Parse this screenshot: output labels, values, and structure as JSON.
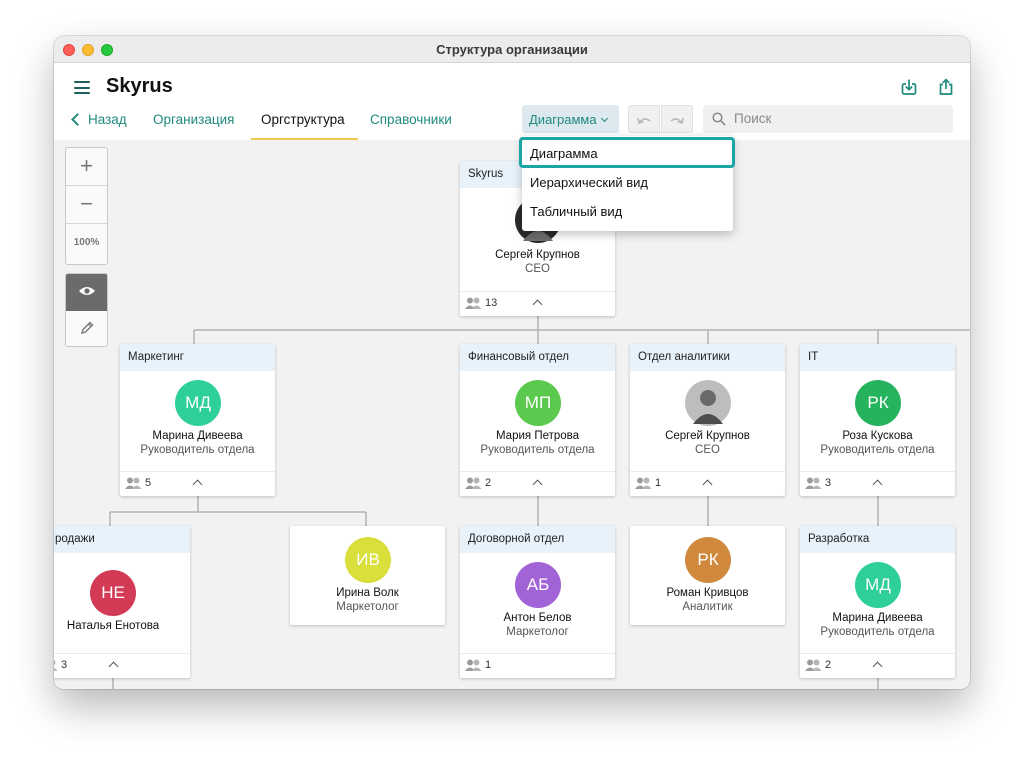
{
  "window": {
    "title": "Структура организации"
  },
  "app": {
    "name": "Skyrus"
  },
  "nav": {
    "back": "Назад",
    "tabs": [
      "Организация",
      "Оргструктура",
      "Справочники"
    ]
  },
  "view_select": {
    "value": "Диаграмма",
    "options": [
      "Диаграмма",
      "Иерархический вид",
      "Табличный вид"
    ]
  },
  "search": {
    "placeholder": "Поиск"
  },
  "zoom": {
    "plus": "+",
    "minus": "−",
    "level": "100%"
  },
  "colors": {
    "accent": "#1f8a7d",
    "tab_underline": "#f2c94c",
    "card_header": "#e8f2fb",
    "highlight": "#1aa6a6"
  },
  "cards": {
    "root": {
      "dept": "Skyrus",
      "name": "Сергей Крупнов",
      "role": "CEO",
      "count": "13",
      "avatar": "photo"
    },
    "marketing": {
      "dept": "Маркетинг",
      "initials": "МД",
      "color": "#2ecf9a",
      "name": "Марина Дивеева",
      "role": "Руководитель отдела",
      "count": "5"
    },
    "finance": {
      "dept": "Финансовый отдел",
      "initials": "МП",
      "color": "#5bc94e",
      "name": "Мария Петрова",
      "role": "Руководитель отдела",
      "count": "2"
    },
    "analytics": {
      "dept": "Отдел аналитики",
      "name": "Сергей Крупнов",
      "role": "CEO",
      "count": "1",
      "avatar": "photo"
    },
    "it": {
      "dept": "IT",
      "initials": "РК",
      "color": "#26b35e",
      "name": "Роза Кускова",
      "role": "Руководитель отдела",
      "count": "3"
    },
    "sales": {
      "dept": "родажи",
      "initials": "НЕ",
      "color": "#d23a55",
      "name": "Наталья Енотова",
      "count": "3"
    },
    "volk": {
      "initials": "ИВ",
      "color": "#d9df3b",
      "name": "Ирина Волк",
      "role": "Маркетолог"
    },
    "contract": {
      "dept": "Договорной отдел",
      "initials": "АБ",
      "color": "#a263d6",
      "name": "Антон Белов",
      "role": "Маркетолог",
      "count": "1"
    },
    "krivtsov": {
      "initials": "РК",
      "color": "#d0893c",
      "name": "Роман Кривцов",
      "role": "Аналитик"
    },
    "dev": {
      "dept": "Разработка",
      "initials": "МД",
      "color": "#2ecf9a",
      "name": "Марина Дивеева",
      "role": "Руководитель отдела",
      "count": "2"
    }
  }
}
